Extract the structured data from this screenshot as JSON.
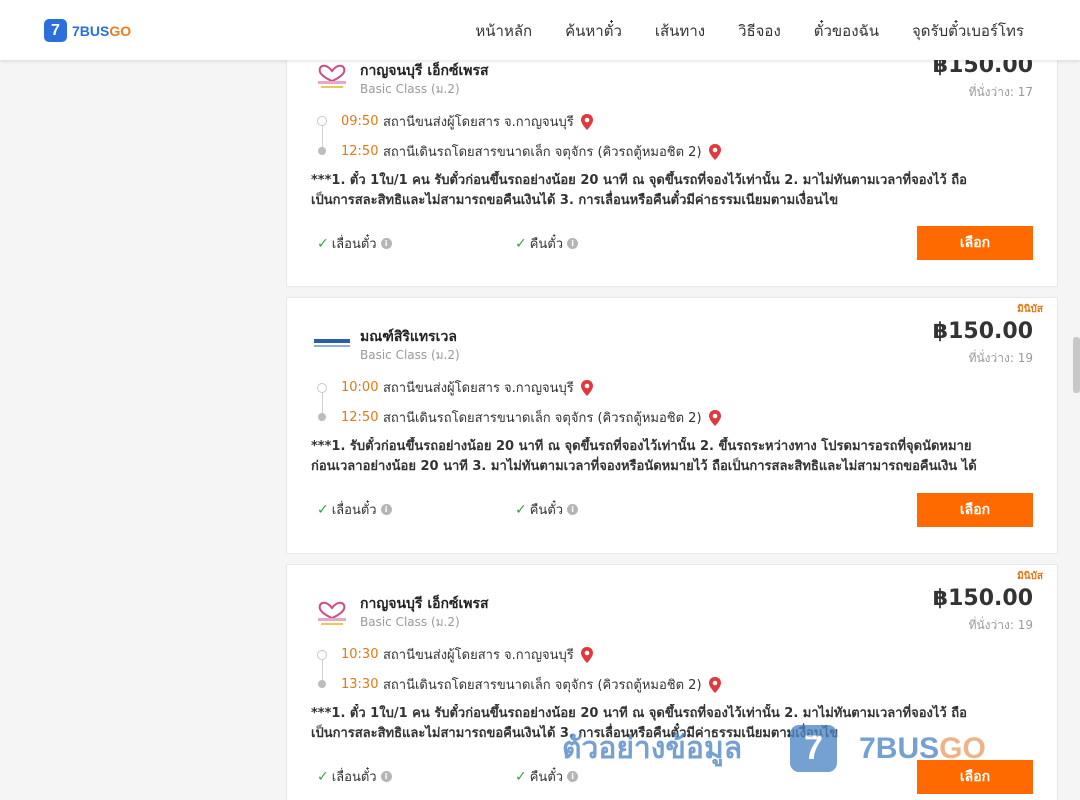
{
  "header": {
    "logo_badge": "7",
    "logo_brand": "7BUS",
    "logo_brand_go": "GO",
    "nav": [
      "หน้าหลัก",
      "ค้นหาตั๋ว",
      "เส้นทาง",
      "วิธีจอง",
      "ตั๋วของฉัน",
      "จุดรับตั๋วเบอร์โทร"
    ]
  },
  "colors": {
    "accent": "#ff6a00",
    "time": "#e07a14",
    "brand_blue": "#2a6fdb",
    "check": "#3aa142"
  },
  "cards": [
    {
      "tag": "",
      "operator": "กาญจนบุรี เอ็กซ์เพรส",
      "class": "Basic Class (ม.2)",
      "price": "฿150.00",
      "seats": "ที่นั่งว่าง: 17",
      "depart_time": "09:50",
      "depart_station": "สถานีขนส่งผู้โดยสาร จ.กาญจนบุรี",
      "arrive_time": "12:50",
      "arrive_station": "สถานีเดินรถโดยสารขนาดเล็ก จตุจักร (คิวรถตู้หมอชิต 2)",
      "desc_line1": "***1. ตั๋ว 1ใบ/1 คน รับตั๋วก่อนขึ้นรถอย่างน้อย 20 นาที ณ จุดขึ้นรถที่จองไว้เท่านั้น 2. มาไม่ทันตามเวลาที่จองไว้ ถือ",
      "desc_line2": "เป็นการสละสิทธิและไม่สามารถขอคืนเงินได้ 3. การเลื่อนหรือคืนตั๋วมีค่าธรรมเนียมตามเงื่อนไข",
      "feature1": "เลื่อนตั๋ว",
      "feature2": "คืนตั๋ว",
      "button": "เลือก"
    },
    {
      "tag": "มินิบัส",
      "operator": "มณฑ์สิริแทรเวล",
      "class": "Basic Class (ม.2)",
      "price": "฿150.00",
      "seats": "ที่นั่งว่าง: 19",
      "depart_time": "10:00",
      "depart_station": "สถานีขนส่งผู้โดยสาร จ.กาญจนบุรี",
      "arrive_time": "12:50",
      "arrive_station": "สถานีเดินรถโดยสารขนาดเล็ก จตุจักร (คิวรถตู้หมอชิต 2)",
      "desc_line1": "***1. รับตั๋วก่อนขึ้นรถอย่างน้อย 20 นาที ณ จุดขึ้นรถที่จองไว้เท่านั้น 2. ขึ้นรถระหว่างทาง โปรดมารอรถที่จุดนัดหมาย",
      "desc_line2": "ก่อนเวลาอย่างน้อย 20 นาที 3. มาไม่ทันตามเวลาที่จองหรือนัดหมายไว้ ถือเป็นการสละสิทธิและไม่สามารถขอคืนเงิน ได้",
      "feature1": "เลื่อนตั๋ว",
      "feature2": "คืนตั๋ว",
      "button": "เลือก"
    },
    {
      "tag": "มินิบัส",
      "operator": "กาญจนบุรี เอ็กซ์เพรส",
      "class": "Basic Class (ม.2)",
      "price": "฿150.00",
      "seats": "ที่นั่งว่าง: 19",
      "depart_time": "10:30",
      "depart_station": "สถานีขนส่งผู้โดยสาร จ.กาญจนบุรี",
      "arrive_time": "13:30",
      "arrive_station": "สถานีเดินรถโดยสารขนาดเล็ก จตุจักร (คิวรถตู้หมอชิต 2)",
      "desc_line1": "***1. ตั๋ว 1ใบ/1 คน รับตั๋วก่อนขึ้นรถอย่างน้อย 20 นาที ณ จุดขึ้นรถที่จองไว้เท่านั้น 2. มาไม่ทันตามเวลาที่จองไว้ ถือ",
      "desc_line2": "เป็นการสละสิทธิและไม่สามารถขอคืนเงินได้ 3. การเลื่อนหรือคืนตั๋วมีค่าธรรมเนียมตามเงื่อนไข",
      "feature1": "เลื่อนตั๋ว",
      "feature2": "คืนตั๋ว",
      "button": "เลือก"
    }
  ],
  "watermark": {
    "text": "ตัวอย่างข้อมูล",
    "badge": "7",
    "brand": "7BUS",
    "brand_go": "GO"
  }
}
